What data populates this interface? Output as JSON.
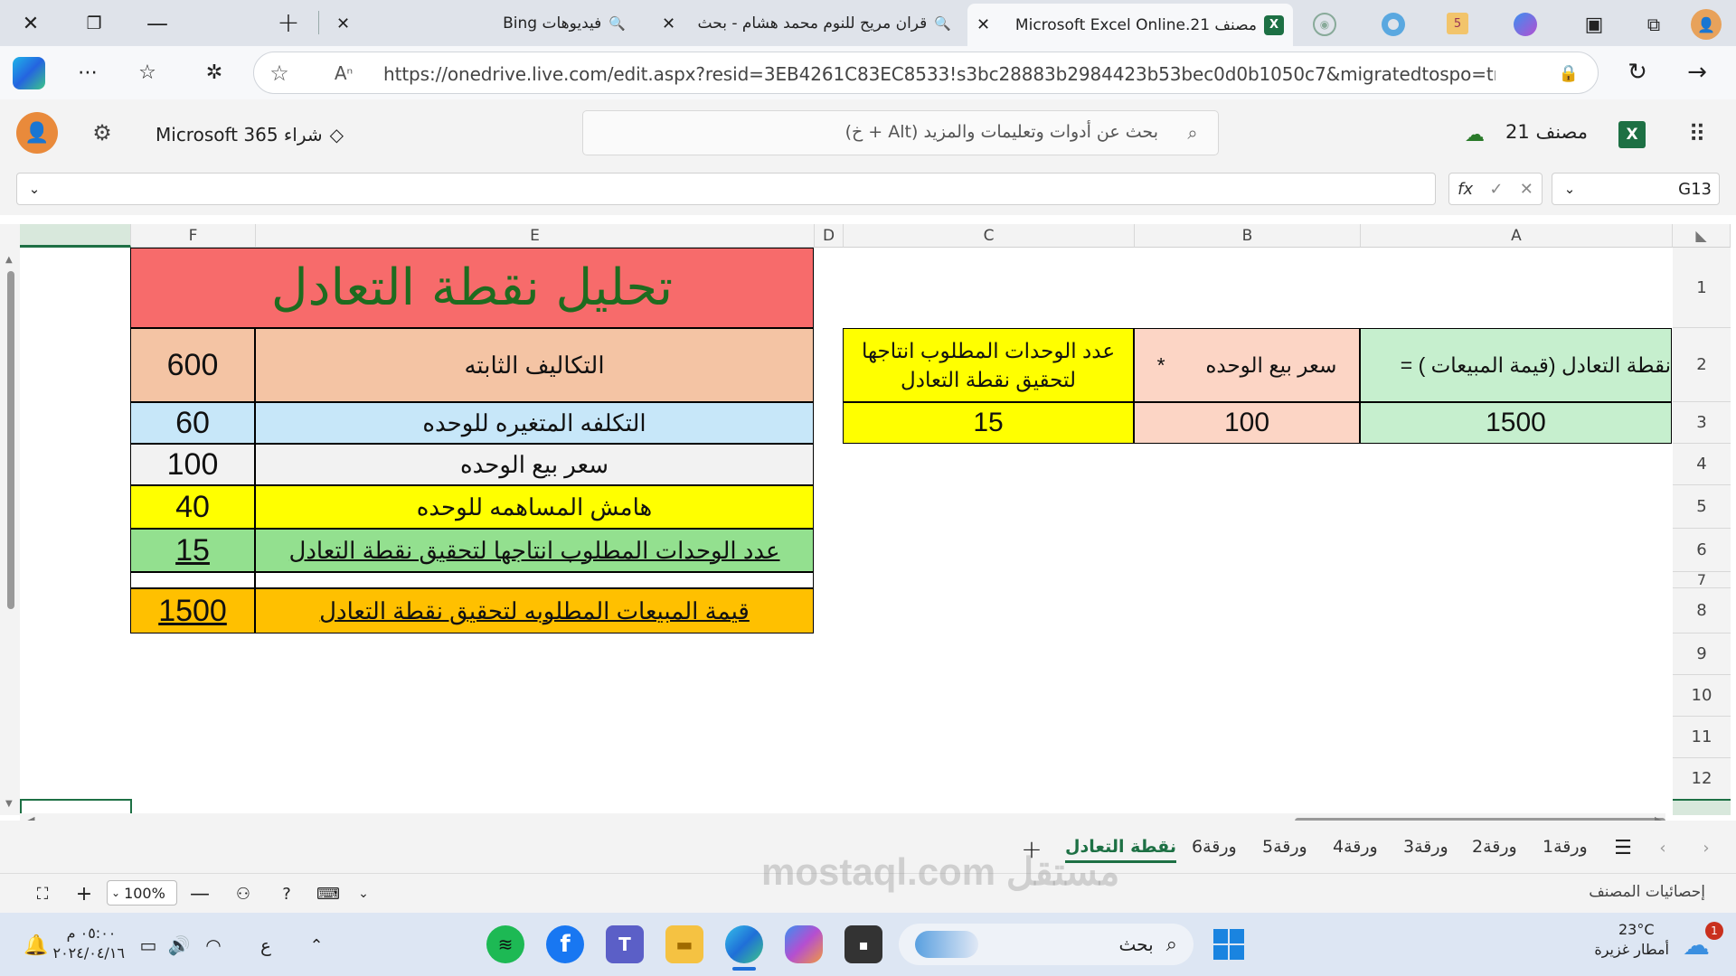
{
  "browser": {
    "tabs": [
      {
        "label": "فيديوهات Bing"
      },
      {
        "label": "قران مريح للنوم محمد هشام - بحث"
      },
      {
        "label": "مصنف 21.Microsoft Excel Online"
      }
    ],
    "pinned_tab_badge": "5",
    "url": "https://onedrive.live.com/edit.aspx?resid=3EB4261C83EC8533!s3bc28883b2984423b53bec0d0b1050c7&migratedtospo=true&wdorigin..."
  },
  "app": {
    "buy_label": "شراء Microsoft 365",
    "search_placeholder": "بحث عن أدوات وتعليمات والمزيد (Alt + خ)",
    "doc_title": "مصنف 21"
  },
  "formula_bar": {
    "name_box": "G13",
    "fx": "fx",
    "value": ""
  },
  "columns": [
    "F",
    "E",
    "D",
    "C",
    "B",
    "A"
  ],
  "rows": [
    "1",
    "2",
    "3",
    "4",
    "5",
    "6",
    "7",
    "8",
    "9",
    "10",
    "11",
    "12"
  ],
  "left_table": {
    "title": "تحليل نقطة التعادل",
    "rows": [
      {
        "label": "التكاليف الثابته",
        "value": "600"
      },
      {
        "label": "التكلفه المتغيره للوحده",
        "value": "60"
      },
      {
        "label": "سعر بيع الوحده",
        "value": "100"
      },
      {
        "label": "هامش المساهمه للوحده",
        "value": "40"
      },
      {
        "label": "عدد الوحدات المطلوب انتاجها لتحقيق نقطة التعادل",
        "value": "15"
      },
      {
        "label": "قيمة المبيعات المطلوبه لتحقيق نقطة التعادل",
        "value": "1500"
      }
    ]
  },
  "right_table": {
    "headers": [
      "نقطة التعادل (قيمة المبيعات ) =",
      "سعر بيع الوحده       *",
      "عدد الوحدات المطلوب انتاجها لتحقيق نقطة التعادل"
    ],
    "values": [
      "1500",
      "100",
      "15"
    ]
  },
  "sheet_tabs": [
    "ورقة1",
    "ورقة2",
    "ورقة3",
    "ورقة4",
    "ورقة5",
    "ورقة6",
    "نقطة التعادل"
  ],
  "status": {
    "zoom": "100%",
    "workbook_stats": "إحصائيات المصنف"
  },
  "taskbar": {
    "weather_temp": "23°C",
    "weather_desc": "أمطار غزيرة",
    "search_label": "بحث",
    "time": "٠٥:٠٠ م",
    "date": "٢٠٢٤/٠٤/١٦",
    "lang": "ع",
    "notif_count": "1"
  },
  "watermark": "مستقل mostaql.com",
  "colors": {
    "title_bg": "#f76b6b",
    "title_fg": "#1f6b1f",
    "fixed_bg": "#f4c4a4",
    "var_bg": "#c7e7f9",
    "price_bg": "#f2f2f2",
    "margin_bg": "#ffff00",
    "units_bg": "#93e08f",
    "sales_bg": "#ffc000",
    "hdr_green": "#c6efce",
    "hdr_peach": "#fcd5c5",
    "hdr_yellow": "#ffff00"
  }
}
